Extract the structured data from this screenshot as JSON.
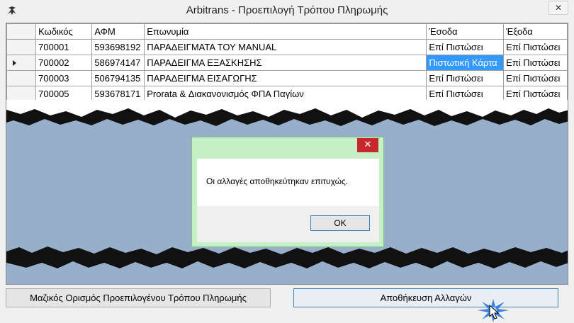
{
  "window": {
    "title": "Arbitrans - Προεπιλογή Τρόπου Πληρωμής",
    "close_glyph": "✕"
  },
  "grid": {
    "columns": [
      "Κωδικός",
      "ΑΦΜ",
      "Επωνυμία",
      "Έσοδα",
      "Έξοδα"
    ],
    "rows": [
      {
        "code": "700001",
        "afm": "593698192",
        "name": "ΠΑΡΑΔΕΙΓΜΑΤΑ ΤΟΥ MANUAL",
        "income": "Επί Πιστώσει",
        "expense": "Επί Πιστώσει"
      },
      {
        "code": "700002",
        "afm": "586974147",
        "name": "ΠΑΡΑΔΕΙΓΜΑ ΕΞΑΣΚΗΣΗΣ",
        "income": "Πιστωτική Κάρτα",
        "expense": "Επί Πιστώσει"
      },
      {
        "code": "700003",
        "afm": "506794135",
        "name": "ΠΑΡΑΔΕΙΓΜΑ ΕΙΣΑΓΩΓΗΣ",
        "income": "Επί Πιστώσει",
        "expense": "Επί Πιστώσει"
      },
      {
        "code": "700005",
        "afm": "593678171",
        "name": "Prorata & Διακανονισμός ΦΠΑ Παγίων",
        "income": "Επί Πιστώσει",
        "expense": "Επί Πιστώσει"
      }
    ],
    "selected_row_index": 1,
    "selected_cell_color": "#3399ff"
  },
  "dialog": {
    "message": "Οι αλλαγές αποθηκεύτηκαν επιτυχώς.",
    "ok_label": "OK",
    "close_glyph": "✕",
    "close_color": "#c7282d"
  },
  "buttons": {
    "bulk_label": "Μαζικός Ορισμός Προεπιλογένου Τρόπου Πληρωμής",
    "save_label": "Αποθήκευση Αλλαγών"
  },
  "icons": {
    "app": "arbitrans-logo-icon",
    "cursor": "mouse-pointer-icon",
    "click": "click-burst-icon"
  }
}
